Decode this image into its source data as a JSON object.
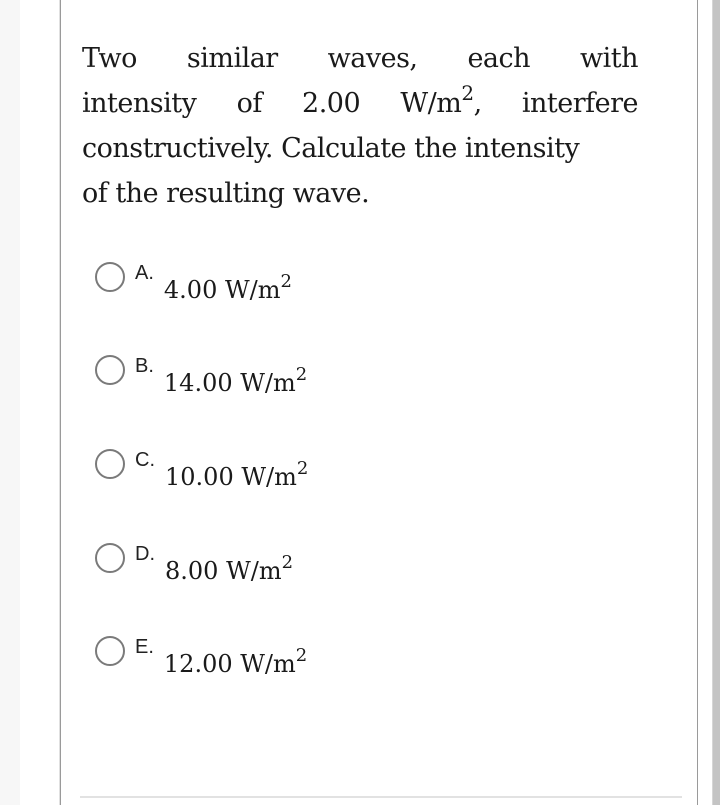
{
  "question": {
    "line1_words": [
      "Two",
      "similar",
      "waves,",
      "each",
      "with"
    ],
    "line2_words_before": [
      "intensity",
      "of",
      "2.00"
    ],
    "line2_unit_base": "W/m",
    "line2_unit_exp": "2",
    "line2_unit_tail": ",",
    "line2_word_after": "interfere",
    "line3": "constructively. Calculate the intensity",
    "line4": "of the resulting wave."
  },
  "options": [
    {
      "letter": "A.",
      "value": "4.00 W/m",
      "exp": "2",
      "selected": false
    },
    {
      "letter": "B.",
      "value": "14.00 W/m",
      "exp": "2",
      "selected": false
    },
    {
      "letter": "C.",
      "value": "10.00 W/m",
      "exp": "2",
      "selected": false
    },
    {
      "letter": "D.",
      "value": "8.00 W/m",
      "exp": "2",
      "selected": false
    },
    {
      "letter": "E.",
      "value": "12.00 W/m",
      "exp": "2",
      "selected": false
    }
  ]
}
